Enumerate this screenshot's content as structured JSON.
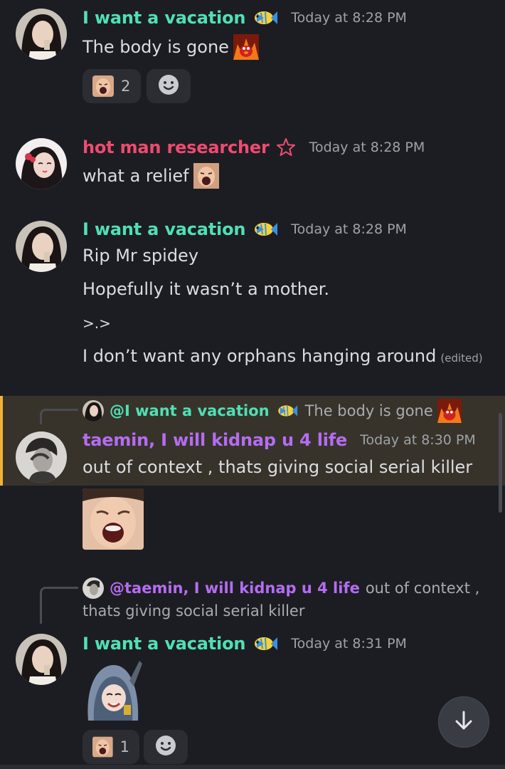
{
  "messages": [
    {
      "username": "I want a vacation",
      "badge": "tropical-fish",
      "timestamp": "Today at 8:28 PM",
      "text": "The body is gone",
      "reactions": [
        {
          "emoji": "screaming-face-sticker",
          "count": "2"
        }
      ]
    },
    {
      "username": "hot man researcher",
      "badge": "star",
      "timestamp": "Today at 8:28 PM",
      "text": "what a relief"
    },
    {
      "username": "I want a vacation",
      "badge": "tropical-fish",
      "timestamp": "Today at 8:28 PM",
      "lines": [
        "Rip Mr spidey",
        "Hopefully it wasn’t a mother.",
        ">.>",
        "I don’t want any orphans hanging around"
      ],
      "edited": "(edited)"
    },
    {
      "reply": {
        "username": "@I want a vacation",
        "text": "The body is gone"
      },
      "username": "taemin, I will kidnap u 4 life",
      "timestamp": "Today at 8:30 PM",
      "text": "out of context , thats giving social serial killer"
    },
    {
      "reply": {
        "username": "@taemin, I will kidnap u 4 life",
        "text_line1": "out of context ,",
        "text_line2": "thats giving social serial killer"
      },
      "username": "I want a vacation",
      "badge": "tropical-fish",
      "timestamp": "Today at 8:31 PM",
      "reactions": [
        {
          "emoji": "screaming-face-sticker",
          "count": "1"
        }
      ]
    }
  ],
  "colors": {
    "background": "#1c1d22",
    "name_green": "#4fe0b5",
    "name_pink": "#f04b6f",
    "name_purple": "#b56cf2",
    "highlight_bar": "#f0b232"
  }
}
